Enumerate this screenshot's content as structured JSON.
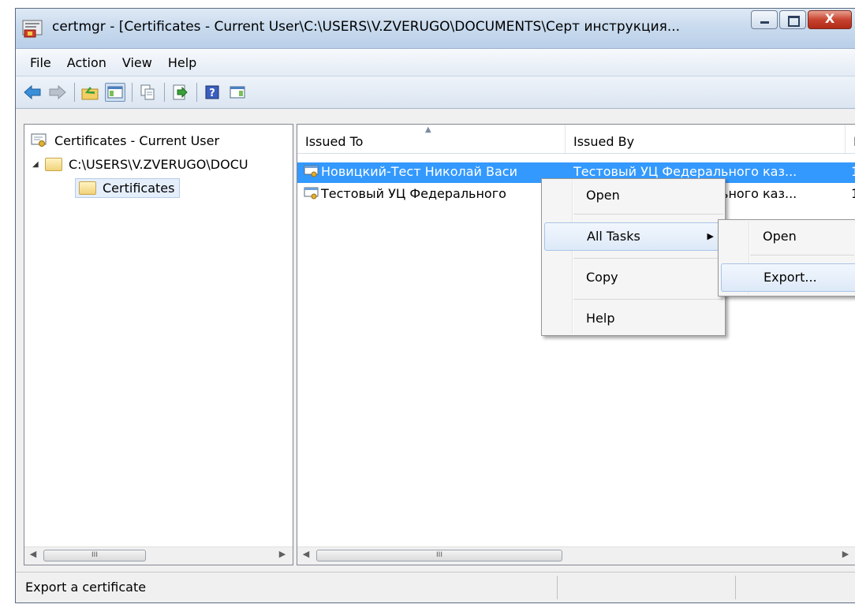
{
  "window": {
    "title": "certmgr - [Certificates - Current User\\C:\\USERS\\V.ZVERUGO\\DOCUMENTS\\Серт инструкция...",
    "close_glyph": "X"
  },
  "menu": [
    "File",
    "Action",
    "View",
    "Help"
  ],
  "tree": {
    "root": "Certificates - Current User",
    "path": "C:\\USERS\\V.ZVERUGO\\DOCU",
    "selected": "Certificates"
  },
  "list": {
    "columns": [
      "Issued To",
      "Issued By",
      "E"
    ],
    "rows": [
      {
        "issued_to": "Новицкий-Тест Николай Васи",
        "issued_by": "Тестовый УЦ Федерального каз...",
        "expiry": "1"
      },
      {
        "issued_to": "Тестовый УЦ Федерального",
        "issued_by": "Тестовый УЦ Федерального каз...",
        "expiry": "1"
      }
    ]
  },
  "context_menu": {
    "items": [
      "Open",
      "All Tasks",
      "Copy",
      "Help"
    ]
  },
  "submenu": {
    "items": [
      "Open",
      "Export..."
    ]
  },
  "status": {
    "text": "Export a certificate"
  },
  "scroll_glyph": "III"
}
